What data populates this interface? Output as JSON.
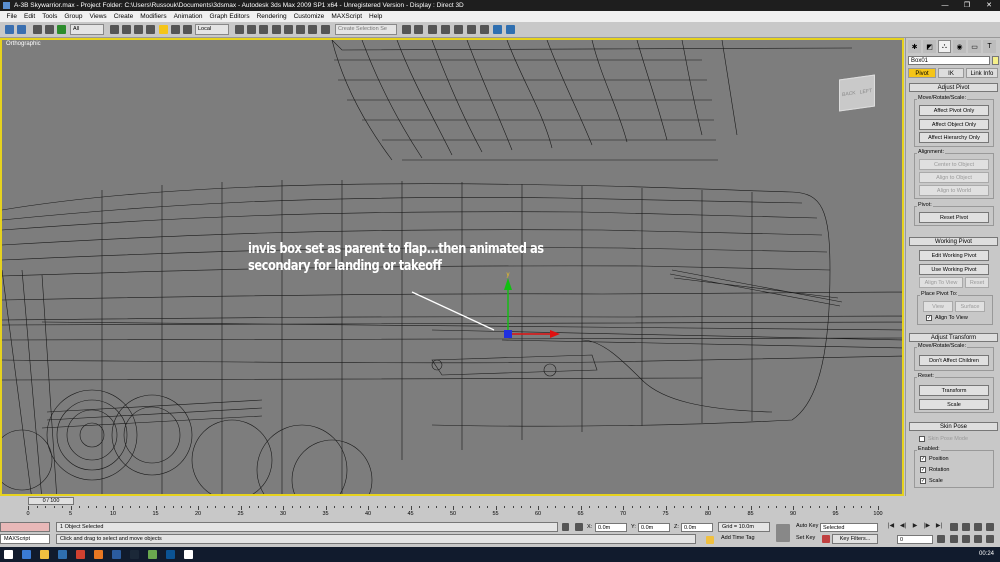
{
  "window": {
    "title": "A-3B Skywarrior.max    - Project Folder: C:\\Users\\Russouk\\Documents\\3dsmax    - Autodesk 3ds Max  2009 SP1  x64  - Unregistered Version    - Display : Direct 3D",
    "controls": [
      "—",
      "❐",
      "✕"
    ]
  },
  "menu": [
    "File",
    "Edit",
    "Tools",
    "Group",
    "Views",
    "Create",
    "Modifiers",
    "Animation",
    "Graph Editors",
    "Rendering",
    "Customize",
    "MAXScript",
    "Help"
  ],
  "toolbar": {
    "selection_filter": "All",
    "ref_coord": "Local",
    "named_selection_placeholder": "Create Selection Se"
  },
  "viewport": {
    "label": "Orthographic",
    "annotation": "invis box set as parent to flap...then animated as secondary for landing or takeoff",
    "viewcube_labels": [
      "BACK",
      "LEFT"
    ],
    "border_color": "#e6d21e",
    "background_color": "#7d7d7d"
  },
  "command_panel": {
    "tab_icons": [
      "create-icon",
      "modify-icon",
      "hierarchy-icon",
      "motion-icon",
      "display-icon",
      "utilities-icon"
    ],
    "tab_glyphs": [
      "✱",
      "◩",
      "⛬",
      "◉",
      "▭",
      "T"
    ],
    "object_name": "Box01",
    "object_color": "#f5f08a",
    "subtabs": [
      "Pivot",
      "IK",
      "Link Info"
    ],
    "adjust_pivot": {
      "title": "Adjust Pivot",
      "move_group": "Move/Rotate/Scale:",
      "buttons": [
        "Affect Pivot Only",
        "Affect Object Only",
        "Affect Hierarchy Only"
      ],
      "alignment_group": "Alignment:",
      "alignment_buttons": [
        "Center to Object",
        "Align to Object",
        "Align to World"
      ],
      "pivot_group": "Pivot:",
      "reset_pivot": "Reset Pivot"
    },
    "working_pivot": {
      "title": "Working Pivot",
      "edit": "Edit Working Pivot",
      "use": "Use Working Pivot",
      "align_to_view": "Align To View",
      "reset": "Reset",
      "place_group": "Place Pivot To:",
      "view": "View",
      "surface": "Surface",
      "align_checkbox": "Align To View"
    },
    "adjust_transform": {
      "title": "Adjust Transform",
      "move_group": "Move/Rotate/Scale:",
      "dont_affect": "Don't Affect Children",
      "reset_group": "Reset:",
      "transform": "Transform",
      "scale": "Scale"
    },
    "skin_pose": {
      "title": "Skin Pose",
      "skin_pose_mode": "Skin Pose Mode",
      "enabled_group": "Enabled:",
      "position": "Position",
      "rotation": "Rotation",
      "scale": "Scale"
    }
  },
  "timeline": {
    "slider_label": "0 / 100",
    "current_frame": 0,
    "total_frames": 100,
    "tick_labels": [
      "0",
      "5",
      "10",
      "15",
      "20",
      "25",
      "30",
      "35",
      "40",
      "45",
      "50",
      "55",
      "60",
      "65",
      "70",
      "75",
      "80",
      "85",
      "90",
      "95",
      "100"
    ]
  },
  "status": {
    "maxscript": "MAXScript",
    "selection_info": "1 Object Selected",
    "prompt": "Click and drag to select and move objects",
    "x_label": "X:",
    "x_value": "0.0m",
    "y_label": "Y:",
    "y_value": "0.0m",
    "z_label": "Z:",
    "z_value": "0.0m",
    "grid": "Grid = 10.0m",
    "add_time_tag": "Add Time Tag",
    "auto_key": "Auto Key",
    "selected_dropdown": "Selected",
    "set_key": "Set Key",
    "key_filters": "Key Filters...",
    "frame_input": "0",
    "playback_glyphs": [
      "|◀",
      "◀|",
      "▶",
      "|▶",
      "▶|"
    ]
  },
  "taskbar": {
    "time": "00:24",
    "icon_colors": [
      "#ffffff",
      "#3a7bd5",
      "#f0c040",
      "#2f6fb0",
      "#d04030",
      "#e87722",
      "#2b5b9e",
      "#1b2838",
      "#6aa84f",
      "#0b5394",
      "#ffffff"
    ]
  }
}
